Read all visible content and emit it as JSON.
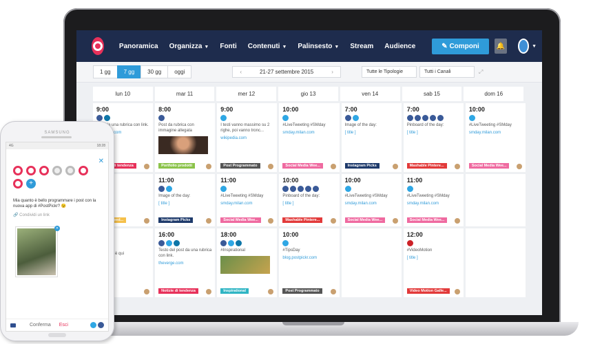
{
  "nav": {
    "items": [
      {
        "label": "Panoramica",
        "has_menu": false
      },
      {
        "label": "Organizza",
        "has_menu": true
      },
      {
        "label": "Fonti",
        "has_menu": false
      },
      {
        "label": "Contenuti",
        "has_menu": true
      },
      {
        "label": "Palinsesto",
        "has_menu": true
      },
      {
        "label": "Stream",
        "has_menu": false
      },
      {
        "label": "Audience",
        "has_menu": false
      }
    ],
    "compose_label": "Componi",
    "brand_color": "#1e2c4d",
    "accent_color": "#2f9bd9"
  },
  "toolbar": {
    "views": [
      "1 gg",
      "7 gg",
      "30 gg",
      "oggi"
    ],
    "active_view": "7 gg",
    "range": "21-27 settembre 2015",
    "filter_types": "Tutte le Tipologie",
    "filter_channels": "Tutti i Canali"
  },
  "days": [
    "lun 10",
    "mar 11",
    "mer 12",
    "gio 13",
    "ven 14",
    "sab 15",
    "dom 16"
  ],
  "posts": {
    "row1": [
      {
        "time": "9:00",
        "text": "Post da una rubrica con link.",
        "link": "theverge.com",
        "tag": "Notizie di tendenza",
        "tag_color": "#e7315a"
      },
      {
        "time": "8:00",
        "text": "Post da rubrica con immagine allegata",
        "link": "",
        "tag": "Portfolio prodotti",
        "tag_color": "#8bc34a"
      },
      {
        "time": "9:00",
        "text": "I testi vanno massimo su 2 righe, poi vanno tronc...",
        "link": "wikipedia.com",
        "tag": "Post Programmato",
        "tag_color": "#555555"
      },
      {
        "time": "10:00",
        "text": "#LiveTweeting #SMday",
        "link": "smday.milan.com",
        "tag": "Social Media Wee...",
        "tag_color": "#ef6aa0"
      },
      {
        "time": "7:00",
        "text": "Image of the day:",
        "link": "[ title ]",
        "tag": "Instagram Picks",
        "tag_color": "#1e3a6b"
      },
      {
        "time": "7:00",
        "text": "Pinboard of the day:",
        "link": "[ title ]",
        "tag": "Mashable Pintere...",
        "tag_color": "#e23a3a"
      },
      {
        "time": "10:00",
        "text": "#LiveTweeting #SMday",
        "link": "smday.milan.com",
        "tag": "Social Media Wee...",
        "tag_color": "#ef6aa0"
      }
    ],
    "row2": [
      {
        "time": "",
        "text": "#Cartoon",
        "link": "",
        "tag": "Social Feed...",
        "tag_color": "#f5c04a"
      },
      {
        "time": "11:00",
        "text": "Image of the day:",
        "link": "[ title ]",
        "tag": "Instagram Picks",
        "tag_color": "#1e3a6b"
      },
      {
        "time": "11:00",
        "text": "#LiveTweeting #SMday",
        "link": "smday.milan.com",
        "tag": "Social Media Wee...",
        "tag_color": "#ef6aa0"
      },
      {
        "time": "10:00",
        "text": "Pinboard of the day:",
        "link": "[ title ]",
        "tag": "Mashable Pintere...",
        "tag_color": "#e23a3a"
      },
      {
        "time": "10:00",
        "text": "#LiveTweeting #SMday",
        "link": "smday.milan.com",
        "tag": "Social Media Wee...",
        "tag_color": "#ef6aa0"
      },
      {
        "time": "11:00",
        "text": "#LiveTweeting #SMday",
        "link": "smday.milan.com",
        "tag": "Social Media Wee...",
        "tag_color": "#ef6aa0"
      }
    ],
    "row3": [
      {
        "time": "",
        "text": "PostPickr è qui",
        "link": "",
        "tag": "",
        "tag_color": "#ffffff"
      },
      {
        "time": "16:00",
        "text": "Testo del post da una rubrica con link.",
        "link": "theverge.com",
        "tag": "Notizie di tendenza",
        "tag_color": "#e7315a"
      },
      {
        "time": "18:00",
        "text": "#Inspirational",
        "link": "",
        "tag": "Inspirational",
        "tag_color": "#2fb5c4"
      },
      {
        "time": "10:00",
        "text": "#TipsDay",
        "link": "blog.postpickr.com",
        "tag": "Post Programmato",
        "tag_color": "#555555"
      },
      {
        "time": "12:00",
        "text": "#VideoMotion",
        "link": "[ title ]",
        "tag": "Video Motion Galle...",
        "tag_color": "#e23a3a"
      },
      {
        "time": "18:00",
        "text": "",
        "link": "",
        "tag": "",
        "tag_color": "#ffffff"
      }
    ]
  },
  "phone": {
    "brand": "SAMSUNG",
    "status_left": "4G",
    "status_right": "18:28",
    "message": "Mia quanto è bello programmare i post con la nuova app di #PostPickr? 😉",
    "share": "Condividi un link",
    "confirm": "Conferma",
    "exit": "Esci"
  }
}
